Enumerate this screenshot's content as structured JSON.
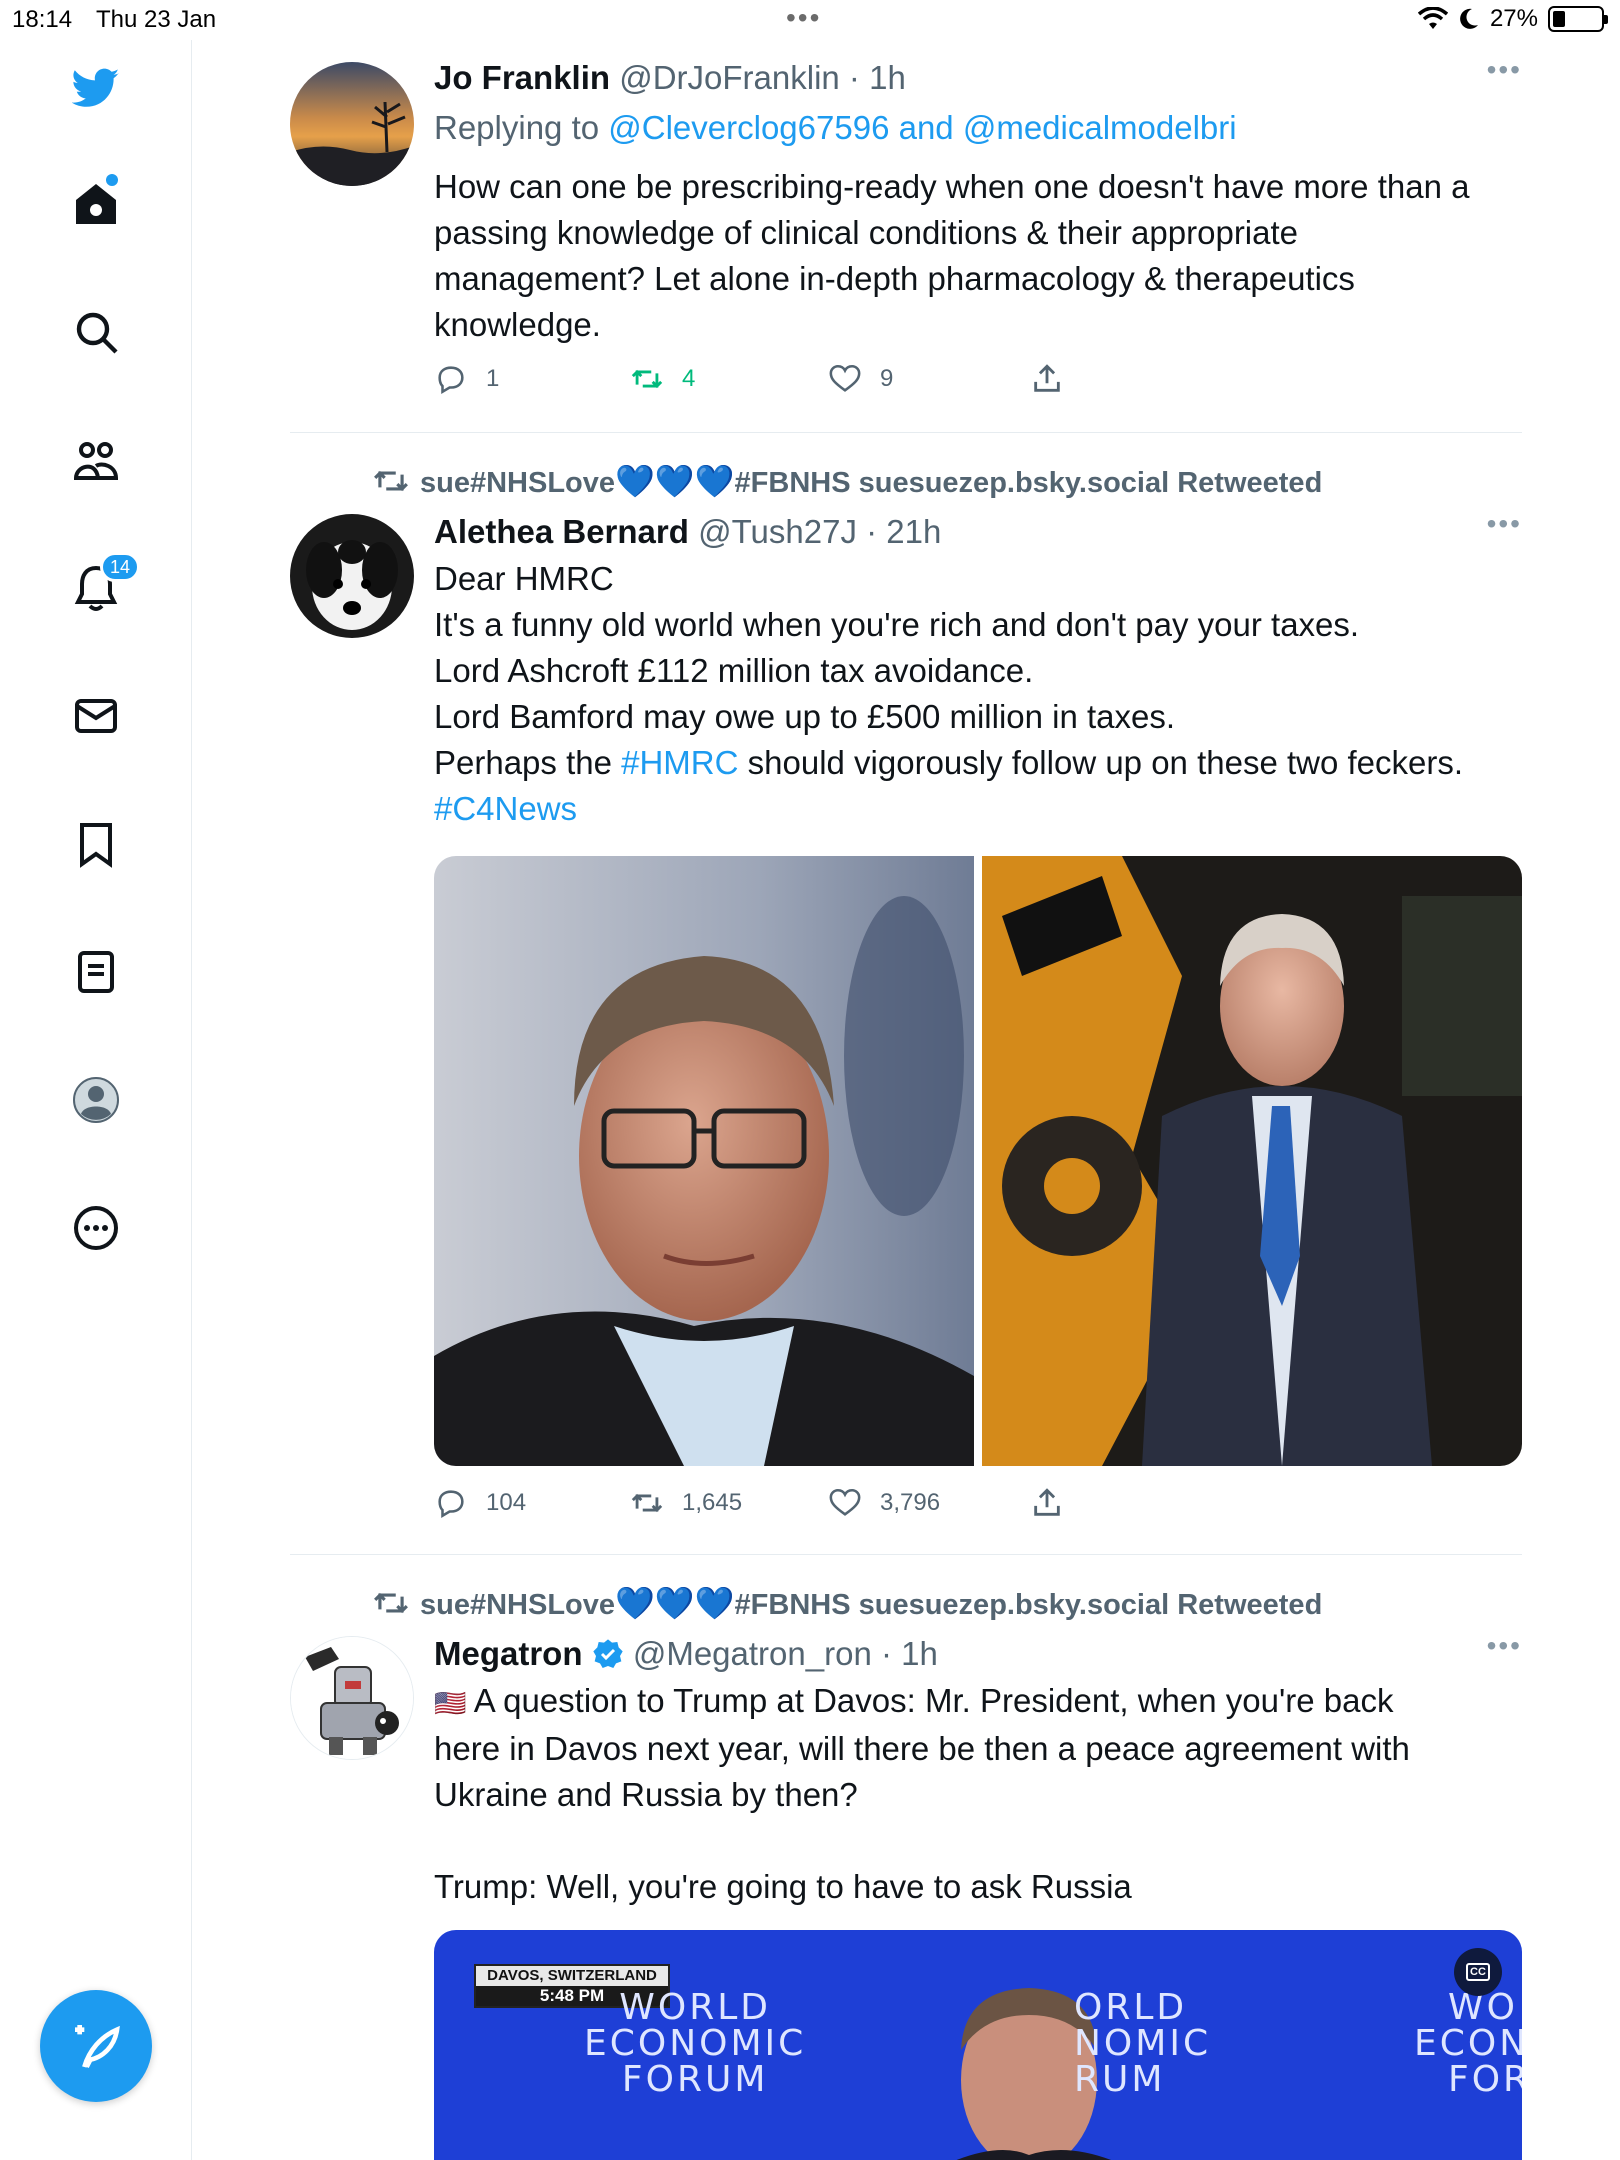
{
  "status_bar": {
    "time": "18:14",
    "date": "Thu 23 Jan",
    "battery": "27%"
  },
  "sidebar": {
    "notifications_badge": "14"
  },
  "tweets": [
    {
      "name": "Jo Franklin",
      "handle": "@DrJoFranklin",
      "time": "1h",
      "replying_prefix": "Replying to ",
      "reply_to_1": "@Cleverclog67596",
      "reply_and": " and ",
      "reply_to_2": "@medicalmodelbri",
      "lines": [
        "How can one be prescribing-ready when one doesn't have more than a",
        "passing knowledge of clinical  conditions & their appropriate",
        "management? Let alone in-depth pharmacology & therapeutics",
        "knowledge."
      ],
      "replies": "1",
      "retweets": "4",
      "likes": "9"
    },
    {
      "retweeted_by_prefix": "sue#NHSLove",
      "retweeted_by_suffix": "#FBNHS suesuezep.bsky.social Retweeted",
      "hearts": "💙💙💙",
      "name": "Alethea Bernard",
      "handle": "@Tush27J",
      "time": "21h",
      "lines": [
        "Dear HMRC",
        "It's a funny old world when you're rich and don't pay your taxes.",
        "Lord Ashcroft  £112 million tax avoidance.",
        "Lord Bamford may owe up to £500 million in taxes."
      ],
      "line5_before": "Perhaps the ",
      "line5_tag": "#HMRC",
      "line5_after": " should vigorously follow up on these two feckers.",
      "hashtag": "#C4News",
      "replies": "104",
      "retweets": "1,645",
      "likes": "3,796"
    },
    {
      "retweeted_by_prefix": "sue#NHSLove",
      "retweeted_by_suffix": "#FBNHS suesuezep.bsky.social Retweeted",
      "hearts": "💙💙💙",
      "name": "Megatron",
      "handle": "@Megatron_ron",
      "time": "1h",
      "flag": "🇺🇸",
      "lines": [
        "A question to Trump at Davos: Mr. President, when you're back",
        "here in Davos next year, will there be then a peace agreement with",
        "Ukraine and Russia by then?"
      ],
      "reply_line": "Trump: Well, you're going to have to ask Russia",
      "video": {
        "location": "DAVOS, SWITZERLAND",
        "time": "5:48 PM",
        "forum_line1": "WORLD",
        "forum_line2": "ECONOMIC",
        "forum_line3": "FORUM",
        "forum_mid_line1": "ORLD",
        "forum_mid_line2": "NOMIC",
        "forum_mid_line3": "RUM",
        "forum_right_line1": "WO",
        "forum_right_line2": "ECON",
        "forum_right_line3": "FOR",
        "cc_label": "CC"
      }
    }
  ],
  "separator": " · "
}
